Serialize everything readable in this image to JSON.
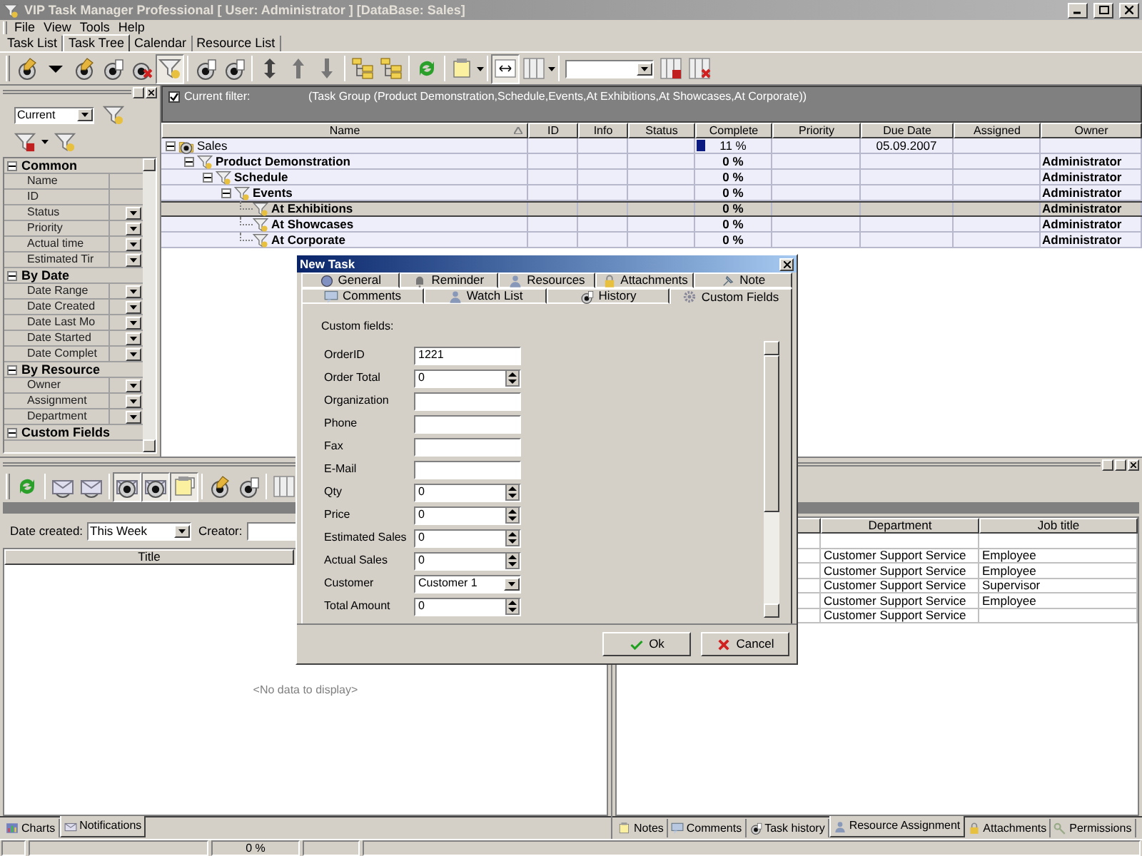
{
  "window": {
    "title": "VIP Task Manager Professional [ User: Administrator ] [DataBase: Sales]"
  },
  "menu": [
    "File",
    "View",
    "Tools",
    "Help"
  ],
  "main_tabs": [
    {
      "label": "Task List",
      "selected": false
    },
    {
      "label": "Task Tree",
      "selected": true
    },
    {
      "label": "Calendar",
      "selected": false
    },
    {
      "label": "Resource List",
      "selected": false
    }
  ],
  "left_panel": {
    "view_select": "Current",
    "groups": [
      {
        "label": "Common",
        "expanded": true,
        "items": [
          {
            "label": "Name",
            "dropdown": false
          },
          {
            "label": "ID",
            "dropdown": false
          },
          {
            "label": "Status",
            "dropdown": true
          },
          {
            "label": "Priority",
            "dropdown": true
          },
          {
            "label": "Actual time",
            "dropdown": true
          },
          {
            "label": "Estimated Tir",
            "dropdown": true
          }
        ]
      },
      {
        "label": "By Date",
        "expanded": true,
        "items": [
          {
            "label": "Date Range",
            "dropdown": true
          },
          {
            "label": "Date Created",
            "dropdown": true
          },
          {
            "label": "Date Last Mo",
            "dropdown": true
          },
          {
            "label": "Date Started",
            "dropdown": true
          },
          {
            "label": "Date Complet",
            "dropdown": true
          }
        ]
      },
      {
        "label": "By Resource",
        "expanded": true,
        "items": [
          {
            "label": "Owner",
            "dropdown": true
          },
          {
            "label": "Assignment",
            "dropdown": true
          },
          {
            "label": "Department",
            "dropdown": true
          }
        ]
      },
      {
        "label": "Custom Fields",
        "expanded": true
      }
    ]
  },
  "filter_bar": {
    "checked": true,
    "label": "Current filter:",
    "text": "(Task Group  (Product Demonstration,Schedule,Events,At Exhibitions,At Showcases,At Corporate))"
  },
  "task_grid": {
    "columns": [
      {
        "label": "Name",
        "sorted": true
      },
      {
        "label": "ID",
        "sorted": false
      },
      {
        "label": "Info",
        "sorted": false
      },
      {
        "label": "Status",
        "sorted": false
      },
      {
        "label": "Complete",
        "sorted": false
      },
      {
        "label": "Priority",
        "sorted": false
      },
      {
        "label": "Due Date",
        "sorted": false
      },
      {
        "label": "Assigned",
        "sorted": false
      },
      {
        "label": "Owner",
        "sorted": false
      }
    ],
    "rows": [
      {
        "name": "Sales",
        "complete": "11 %",
        "level": 0.11,
        "due_date": "05.09.2007",
        "bold": false,
        "selected": false,
        "expanded": true,
        "children": [
          {
            "name": "Product Demonstration",
            "complete": "0 %",
            "owner": "Administrator",
            "bold": true,
            "selected": false,
            "expanded": true,
            "children": [
              {
                "name": "Schedule",
                "complete": "0 %",
                "owner": "Administrator",
                "bold": true,
                "selected": false,
                "expanded": true,
                "children": [
                  {
                    "name": "Events",
                    "complete": "0 %",
                    "owner": "Administrator",
                    "bold": true,
                    "selected": false,
                    "expanded": true,
                    "children": [
                      {
                        "name": "At Exhibitions",
                        "complete": "0 %",
                        "owner": "Administrator",
                        "bold": true,
                        "selected": true
                      },
                      {
                        "name": "At Showcases",
                        "complete": "0 %",
                        "owner": "Administrator",
                        "bold": true,
                        "selected": false
                      },
                      {
                        "name": "At Corporate",
                        "complete": "0 %",
                        "owner": "Administrator",
                        "bold": true,
                        "selected": false
                      }
                    ]
                  }
                ]
              }
            ]
          }
        ]
      }
    ]
  },
  "notifications_panel": {
    "date_created_label": "Date created:",
    "date_created": "This Week",
    "creator_label": "Creator:",
    "columns": [
      "Title"
    ],
    "empty_text": "<No data to display>",
    "tabs": [
      {
        "label": "Charts",
        "selected": false
      },
      {
        "label": "Notifications",
        "selected": true
      }
    ]
  },
  "resource_panel": {
    "columns": [
      "Department",
      "Job title"
    ],
    "rows": [
      [
        "",
        ""
      ],
      [
        "Customer Support Service",
        "Employee"
      ],
      [
        "Customer Support Service",
        "Employee"
      ],
      [
        "Customer Support Service",
        "Supervisor"
      ],
      [
        "Customer Support Service",
        "Employee"
      ],
      [
        "Customer Support Service",
        ""
      ]
    ],
    "tabs": [
      {
        "label": "Notes",
        "selected": false
      },
      {
        "label": "Comments",
        "selected": false
      },
      {
        "label": "Task history",
        "selected": false
      },
      {
        "label": "Resource Assignment",
        "selected": true
      },
      {
        "label": "Attachments",
        "selected": false
      },
      {
        "label": "Permissions",
        "selected": false
      }
    ]
  },
  "status_bar": {
    "progress": "0 %"
  },
  "dialog": {
    "title": "New Task",
    "tab_rows": [
      [
        {
          "label": "General",
          "selected": false
        },
        {
          "label": "Reminder",
          "selected": false
        },
        {
          "label": "Resources",
          "selected": false
        },
        {
          "label": "Attachments",
          "selected": false
        },
        {
          "label": "Note",
          "selected": false
        }
      ],
      [
        {
          "label": "Comments",
          "selected": false
        },
        {
          "label": "Watch List",
          "selected": false
        },
        {
          "label": "History",
          "selected": false
        },
        {
          "label": "Custom Fields",
          "selected": true
        }
      ]
    ],
    "section_label": "Custom fields:",
    "fields": [
      {
        "label": "OrderID",
        "kind": "text",
        "value": "1221"
      },
      {
        "label": "Order Total",
        "kind": "spin",
        "value": "0"
      },
      {
        "label": "Organization",
        "kind": "text"
      },
      {
        "label": "Phone",
        "kind": "text"
      },
      {
        "label": "Fax",
        "kind": "text"
      },
      {
        "label": "E-Mail",
        "kind": "text"
      },
      {
        "label": "Qty",
        "kind": "spin",
        "value": "0"
      },
      {
        "label": "Price",
        "kind": "spin",
        "value": "0"
      },
      {
        "label": "Estimated Sales",
        "kind": "spin",
        "value": "0"
      },
      {
        "label": "Actual Sales",
        "kind": "spin",
        "value": "0"
      },
      {
        "label": "Customer",
        "kind": "combo",
        "value": "Customer 1"
      },
      {
        "label": "Total Amount",
        "kind": "spin",
        "value": "0"
      }
    ],
    "buttons": [
      {
        "label": "Ok",
        "kind": "ok"
      },
      {
        "label": "Cancel",
        "kind": "cancel"
      }
    ]
  }
}
